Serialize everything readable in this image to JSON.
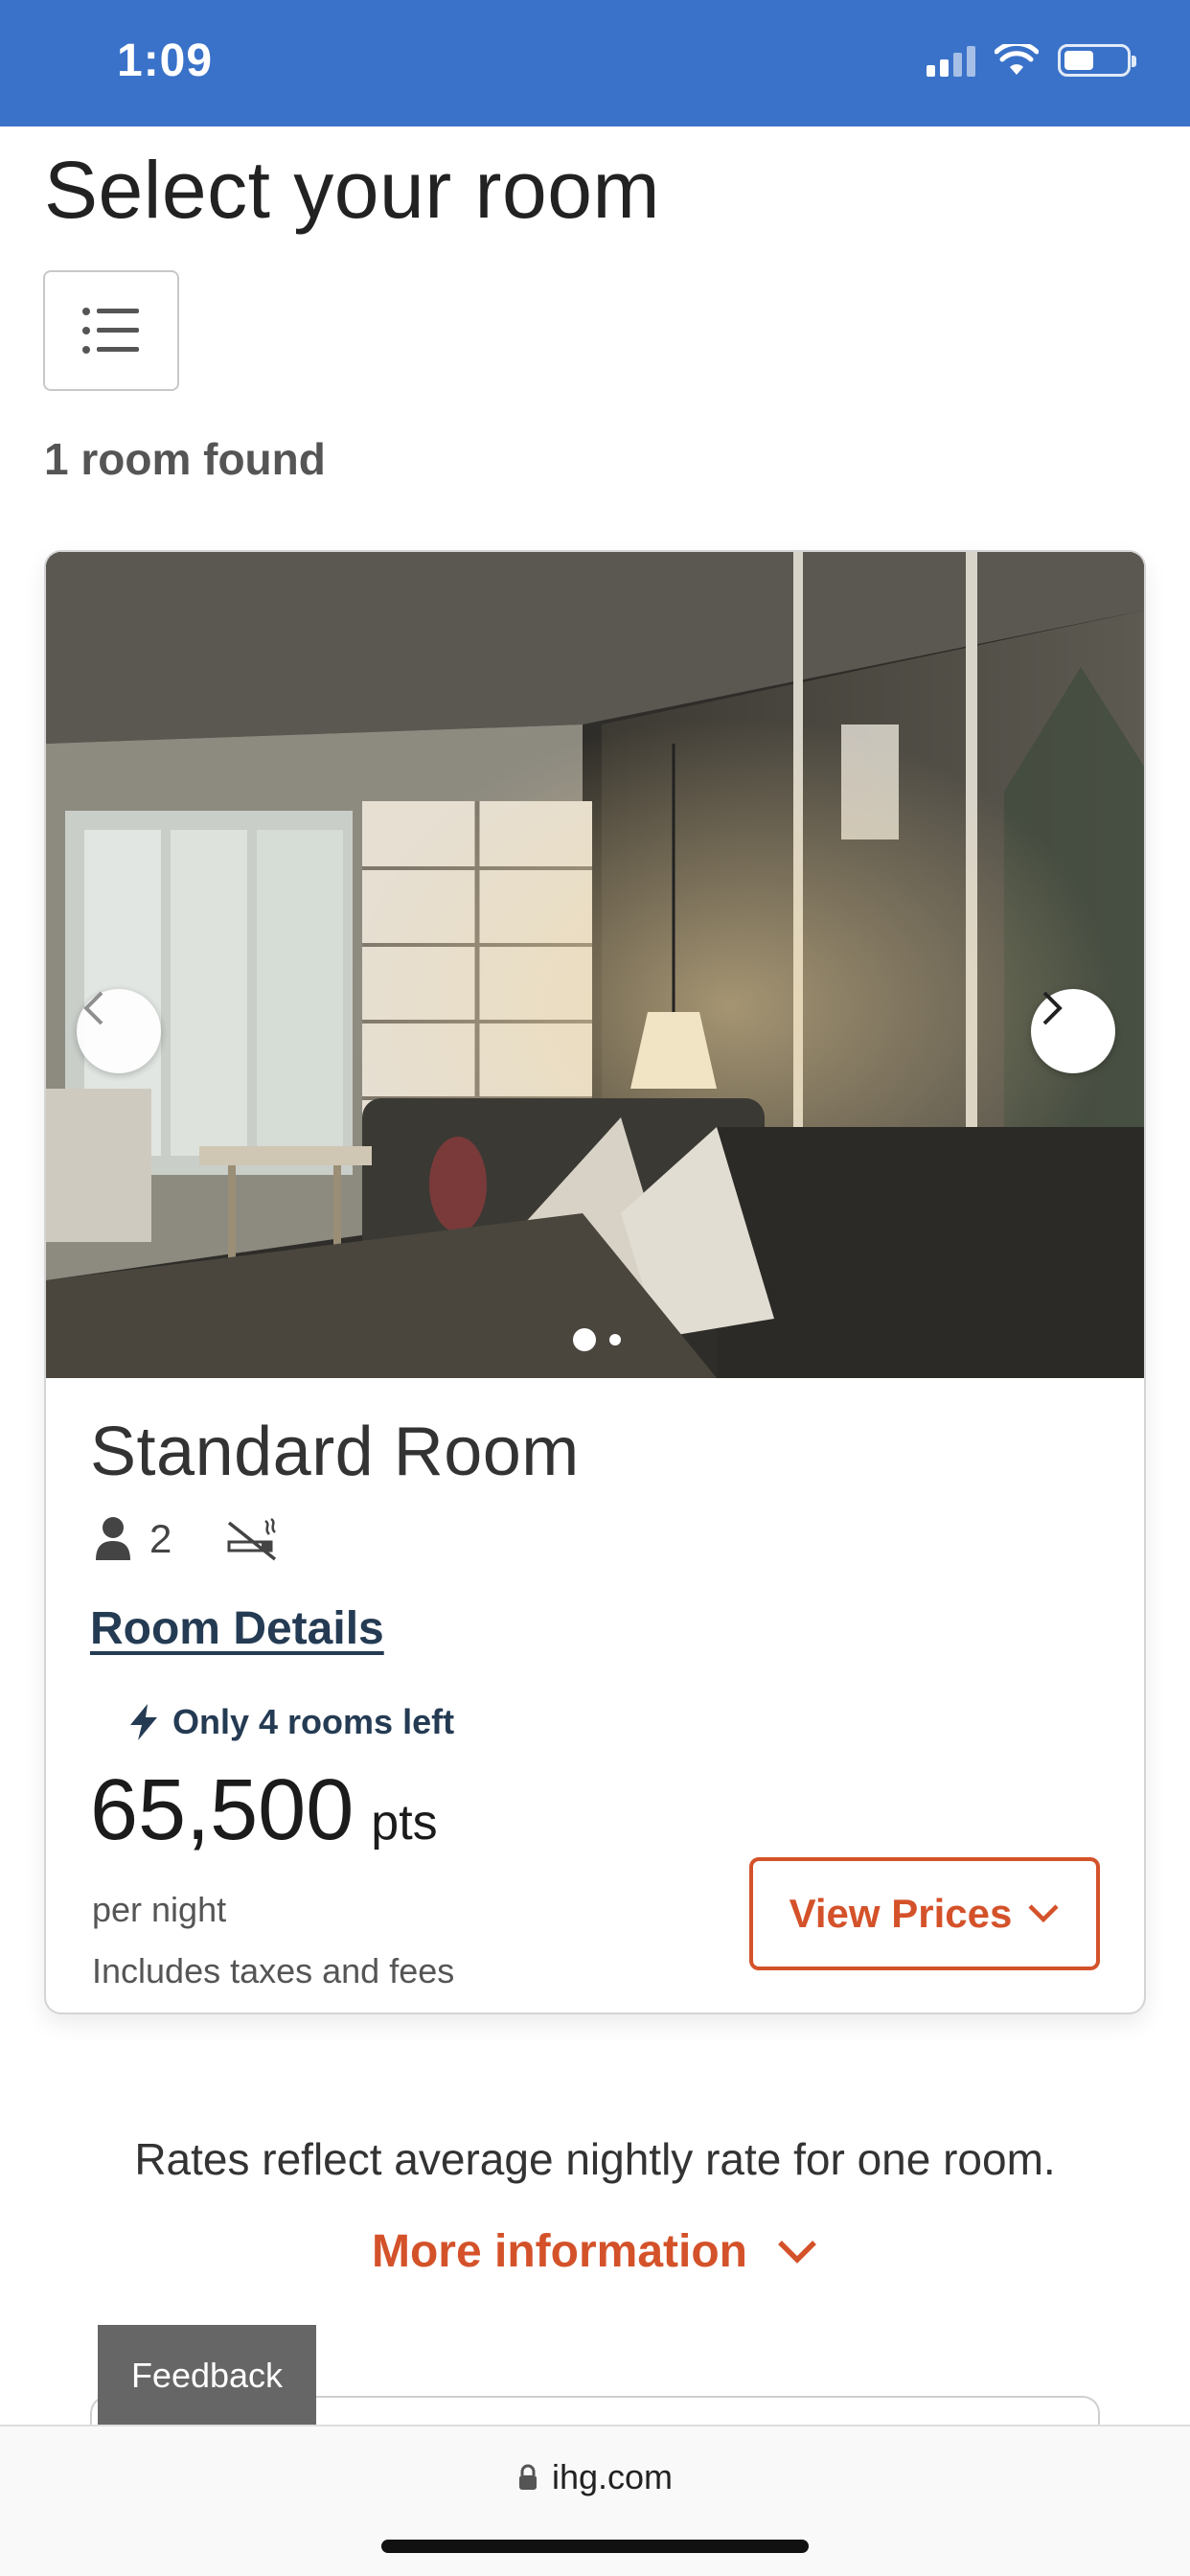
{
  "status_bar": {
    "time": "1:09"
  },
  "header": {
    "title": "Select your room",
    "results_count": "1 room found"
  },
  "room": {
    "name": "Standard Room",
    "capacity": "2",
    "details_link": "Room Details",
    "availability": "Only 4 rooms left",
    "price": "65,500",
    "price_unit": "pts",
    "per_night": "per night",
    "taxes_note": "Includes taxes and fees",
    "view_prices_label": "View Prices",
    "carousel": {
      "total_images": 2,
      "current_index": 1
    }
  },
  "footer": {
    "rates_note": "Rates reflect average nightly rate for one room.",
    "more_info_label": "More information",
    "feedback_label": "Feedback"
  },
  "browser": {
    "url": "ihg.com"
  },
  "colors": {
    "status_bar": "#3a72c9",
    "accent": "#d4522a",
    "link": "#243b53"
  },
  "icons": [
    "signal-icon",
    "wifi-icon",
    "battery-icon",
    "filter-list-icon",
    "chevron-left-icon",
    "chevron-right-icon",
    "person-icon",
    "no-smoking-icon",
    "lightning-icon",
    "chevron-down-icon",
    "lock-icon"
  ]
}
